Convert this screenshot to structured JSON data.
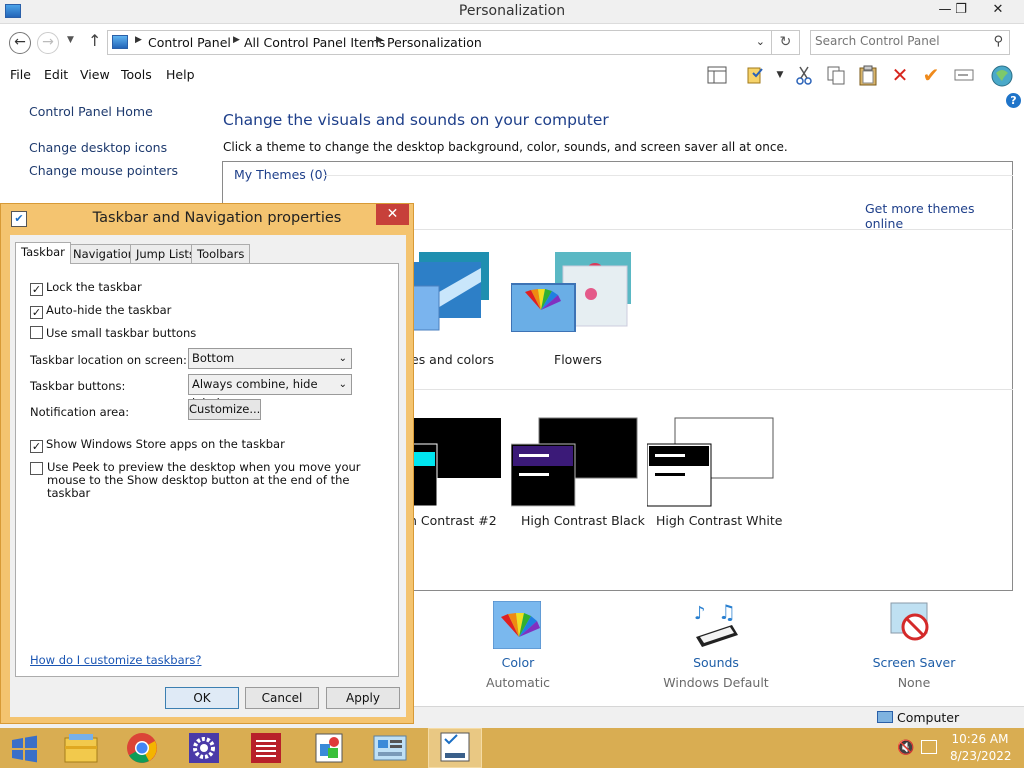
{
  "window": {
    "title": "Personalization",
    "controls": {
      "minimize": "—",
      "maximize": "❐",
      "close": "✕"
    }
  },
  "address": {
    "crumbs": [
      "Control Panel",
      "All Control Panel Items",
      "Personalization"
    ],
    "search_placeholder": "Search Control Panel"
  },
  "menu": [
    "File",
    "Edit",
    "View",
    "Tools",
    "Help"
  ],
  "toolbar_icons": [
    "layout-icon",
    "properties-icon",
    "cut-icon",
    "copy-icon",
    "paste-icon",
    "delete-icon",
    "check-icon",
    "rename-icon",
    "globe-icon"
  ],
  "sidebar": {
    "home": "Control Panel Home",
    "links": [
      "Change desktop icons",
      "Change mouse pointers"
    ]
  },
  "main": {
    "heading": "Change the visuals and sounds on your computer",
    "subheading": "Click a theme to change the desktop background, color, sounds, and screen saver all at once.",
    "my_themes": "My Themes (0)",
    "get_more": "Get more themes online",
    "themes": [
      {
        "label": "es and colors"
      },
      {
        "label": "Flowers"
      }
    ],
    "high_contrast": [
      {
        "label": "h Contrast #2"
      },
      {
        "label": "High Contrast Black"
      },
      {
        "label": "High Contrast White"
      }
    ],
    "bottom": [
      {
        "title": "Color",
        "sub": "Automatic"
      },
      {
        "title": "Sounds",
        "sub": "Windows Default"
      },
      {
        "title": "Screen Saver",
        "sub": "None"
      }
    ]
  },
  "status_bar": {
    "label": "Computer"
  },
  "dialog": {
    "title": "Taskbar and Navigation properties",
    "tabs": [
      "Taskbar",
      "Navigation",
      "Jump Lists",
      "Toolbars"
    ],
    "checkboxes": {
      "lock": {
        "label": "Lock the taskbar",
        "checked": true
      },
      "autohide": {
        "label": "Auto-hide the taskbar",
        "checked": true
      },
      "small": {
        "label": "Use small taskbar buttons",
        "checked": false
      },
      "store": {
        "label": "Show Windows Store apps on the taskbar",
        "checked": true
      },
      "peek": {
        "label": "Use Peek to preview the desktop when you move your mouse to the Show desktop button at the end of the taskbar",
        "checked": false
      }
    },
    "location": {
      "label": "Taskbar location on screen:",
      "value": "Bottom"
    },
    "buttons_combine": {
      "label": "Taskbar buttons:",
      "value": "Always combine, hide labels"
    },
    "notification": {
      "label": "Notification area:",
      "button": "Customize..."
    },
    "help_link": "How do I customize taskbars?",
    "ok": "OK",
    "cancel": "Cancel",
    "apply": "Apply"
  },
  "taskbar": {
    "time": "10:26 AM",
    "date": "8/23/2022",
    "apps": [
      "start-icon",
      "file-explorer-icon",
      "chrome-icon",
      "settings-icon",
      "app-red-icon",
      "paint-icon",
      "control-panel-icon",
      "taskbar-properties-icon"
    ]
  }
}
